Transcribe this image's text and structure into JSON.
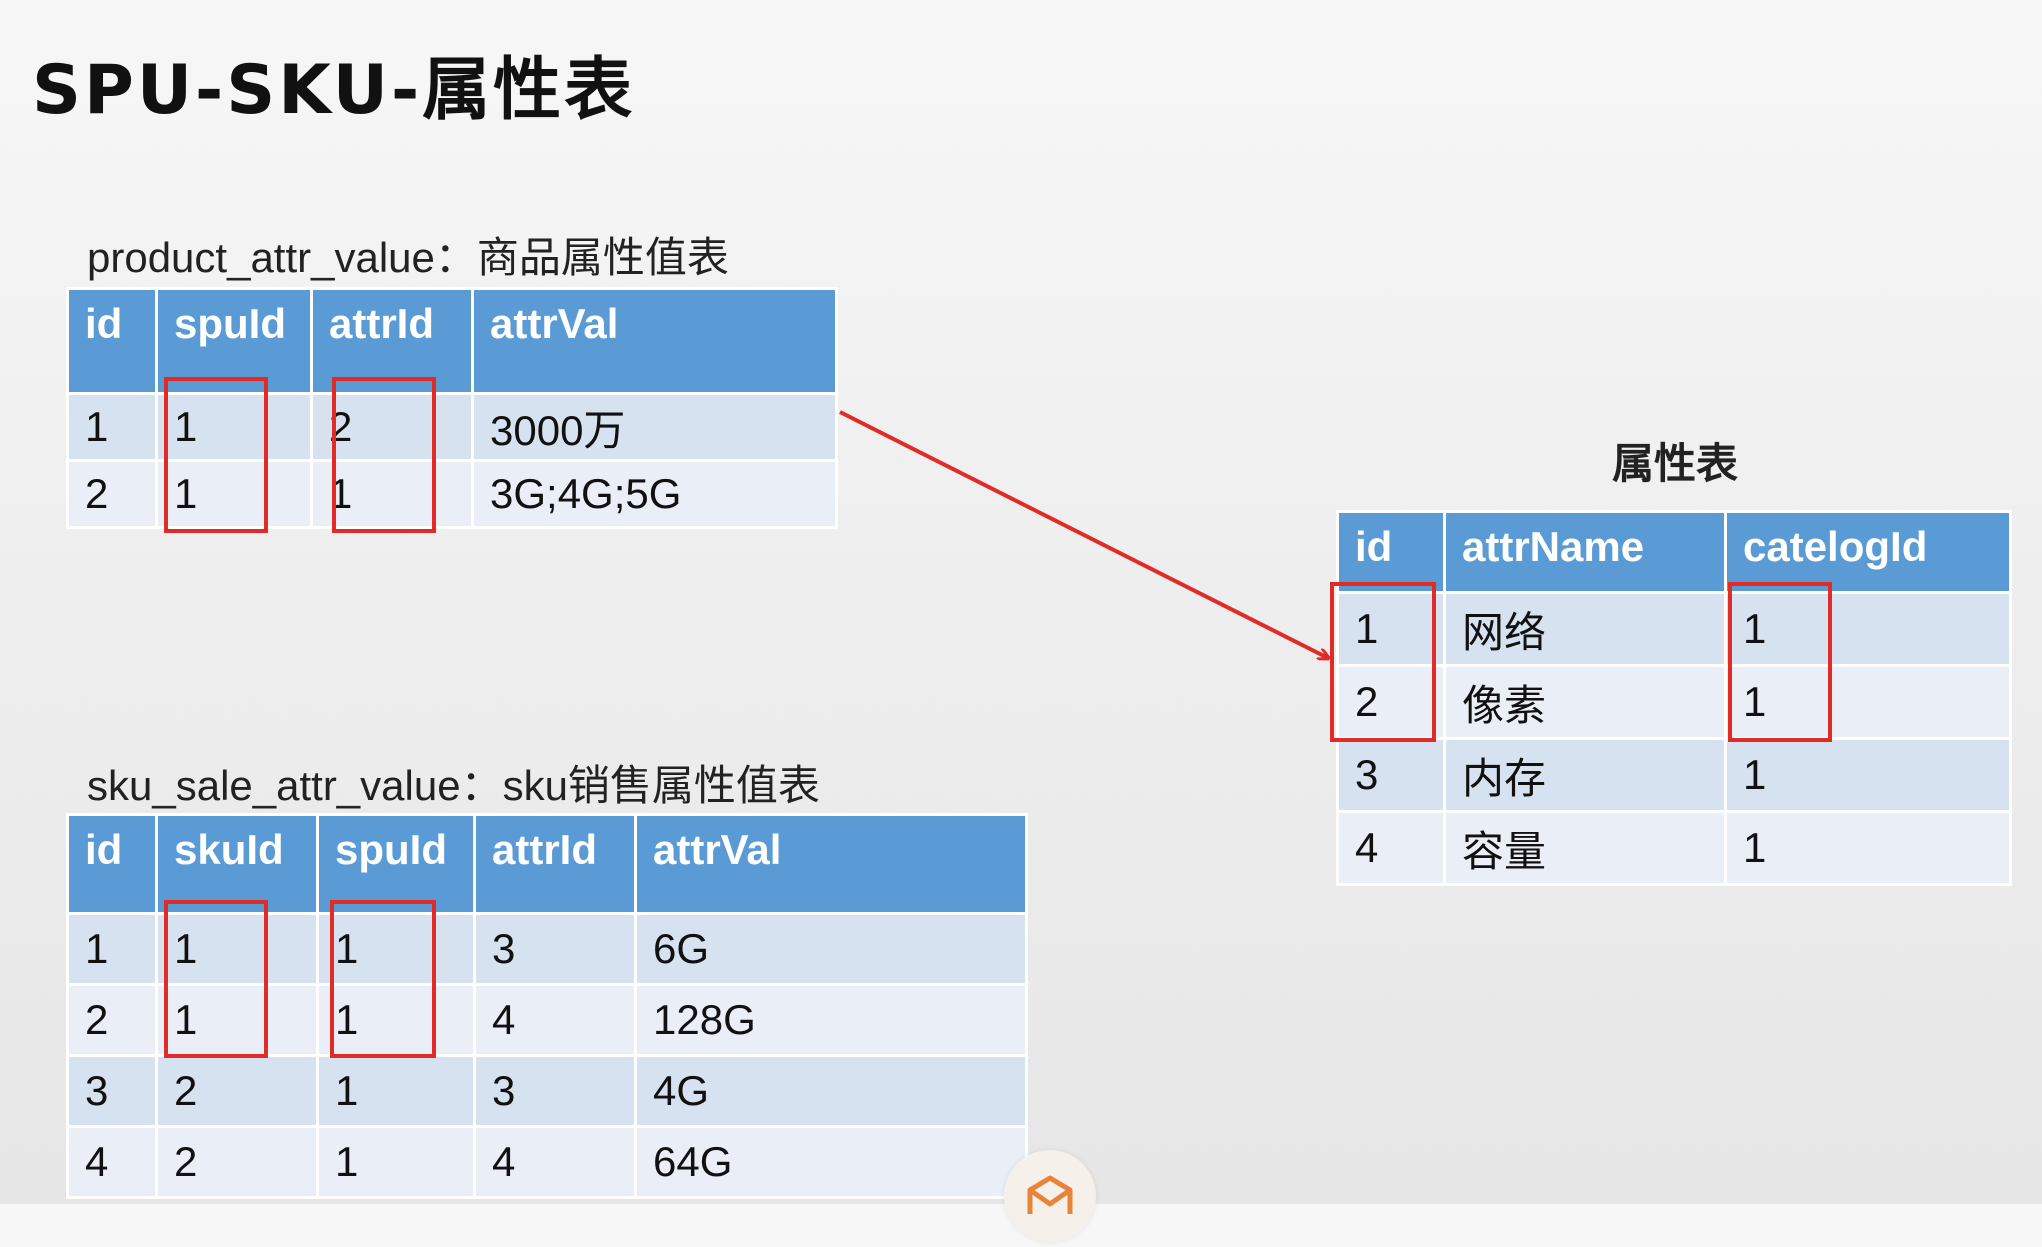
{
  "title": "SPU-SKU-属性表",
  "product_table": {
    "caption": "product_attr_value：商品属性值表",
    "headers": [
      "id",
      "spuId",
      "attrId",
      "attrVal"
    ],
    "rows": [
      [
        "1",
        "1",
        "2",
        "3000万"
      ],
      [
        "2",
        "1",
        "1",
        "3G;4G;5G"
      ]
    ]
  },
  "attr_table": {
    "caption": "属性表",
    "headers": [
      "id",
      "attrName",
      "catelogId"
    ],
    "rows": [
      [
        "1",
        "网络",
        "1"
      ],
      [
        "2",
        "像素",
        "1"
      ],
      [
        "3",
        "内存",
        "1"
      ],
      [
        "4",
        "容量",
        "1"
      ]
    ]
  },
  "sku_table": {
    "caption": "sku_sale_attr_value：sku销售属性值表",
    "headers": [
      "id",
      "skuId",
      "spuId",
      "attrId",
      "attrVal"
    ],
    "rows": [
      [
        "1",
        "1",
        "1",
        "3",
        "6G"
      ],
      [
        "2",
        "1",
        "1",
        "4",
        "128G"
      ],
      [
        "3",
        "2",
        "1",
        "3",
        "4G"
      ],
      [
        "4",
        "2",
        "1",
        "4",
        "64G"
      ]
    ]
  },
  "colors": {
    "header": "#5b9bd5",
    "row_dark": "#d7e2f0",
    "row_light": "#eaeff7",
    "highlight": "#e12b26"
  }
}
